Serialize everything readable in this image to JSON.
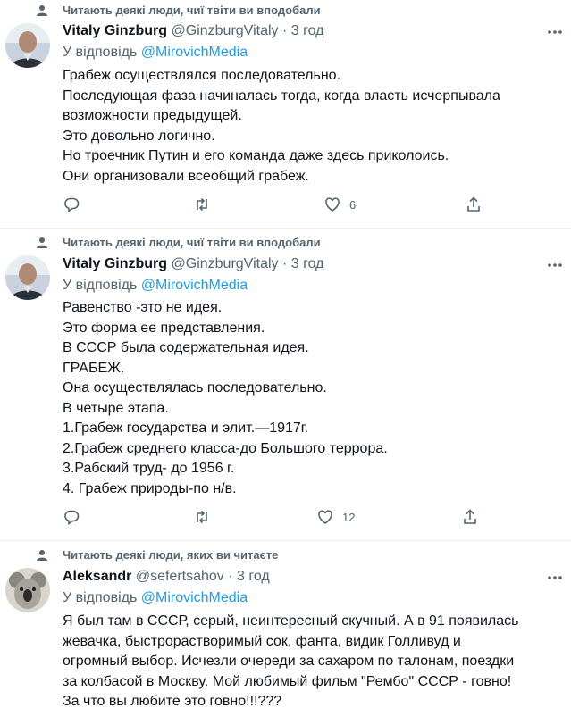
{
  "colors": {
    "text": "#0f1419",
    "muted": "#536471",
    "link": "#1d9bf0",
    "divider": "#eff3f4"
  },
  "tweets": [
    {
      "social_context": "Читають деякі люди, чиї твіти ви вподобали",
      "social_icon": "heart-person-icon",
      "name": "Vitaly Ginzburg",
      "handle": "@GinzburgVitaly",
      "separator": "·",
      "time": "3 год",
      "reply_prefix": "У відповідь",
      "reply_to": "@MirovichMedia",
      "lines": [
        "Грабеж осуществлялся последовательно.",
        "Последующая фаза начиналась тогда, когда власть исчерпывала",
        "возможности предыдущей.",
        "Это довольно логично.",
        "Но троечник Путин и его команда даже здесь приколоись.",
        "Они организовали всеобщий грабеж."
      ],
      "replies": "",
      "retweets": "",
      "likes": "6"
    },
    {
      "social_context": "Читають деякі люди, чиї твіти ви вподобали",
      "social_icon": "heart-person-icon",
      "name": "Vitaly Ginzburg",
      "handle": "@GinzburgVitaly",
      "separator": "·",
      "time": "3 год",
      "reply_prefix": "У відповідь",
      "reply_to": "@MirovichMedia",
      "lines": [
        "Равенство -это не идея.",
        "Это форма ее представления.",
        "В СССР была содержательная идея.",
        "ГРАБЕЖ.",
        "Она осуществлялась последовательно.",
        "В четыре этапа.",
        "1.Грабеж государства и элит.—1917г.",
        "2.Грабеж среднего класса-до Большого террора.",
        "3.Рабский труд- до 1956 г.",
        "4. Грабеж природы-по н/в."
      ],
      "replies": "",
      "retweets": "",
      "likes": "12"
    },
    {
      "social_context": "Читають деякі люди, яких ви читаєте",
      "social_icon": "person-icon",
      "name": "Aleksandr",
      "handle": "@sefertsahov",
      "separator": "·",
      "time": "3 год",
      "reply_prefix": "У відповідь",
      "reply_to": "@MirovichMedia",
      "lines": [
        "Я был там в СССР, серый, неинтересный скучный. А в 91 появилась",
        "жевачка, быстрорастворимый сок, фанта, видик Голливуд и",
        "огромный выбор. Исчезли очереди за сахаром по талонам, поездки",
        "за колбасой в Москву. Мой любимый фильм \"Рембо\" СССР - говно!",
        "За что вы любите это говно!!!???"
      ]
    }
  ]
}
